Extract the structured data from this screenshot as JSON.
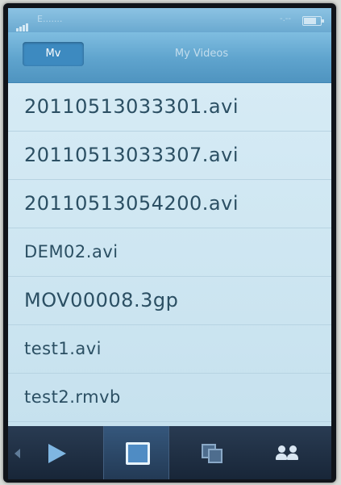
{
  "status_bar": {
    "carrier": "E.......",
    "time": "-.--"
  },
  "tabs": [
    {
      "label": "Mv",
      "active": true
    },
    {
      "label": "My Videos",
      "active": false
    }
  ],
  "files": [
    "20110513033301.avi",
    "20110513033307.avi",
    "20110513054200.avi",
    "DEM02.avi",
    "MOV00008.3gp",
    "test1.avi",
    "test2.rmvb"
  ],
  "bottom_nav": [
    {
      "icon": "play-icon"
    },
    {
      "icon": "video-icon",
      "selected": true
    },
    {
      "icon": "copy-icon"
    },
    {
      "icon": "people-icon"
    }
  ],
  "colors": {
    "accent": "#5ea3cd",
    "list_text": "#2b4f63",
    "bottom_bar": "#1f2f44"
  }
}
